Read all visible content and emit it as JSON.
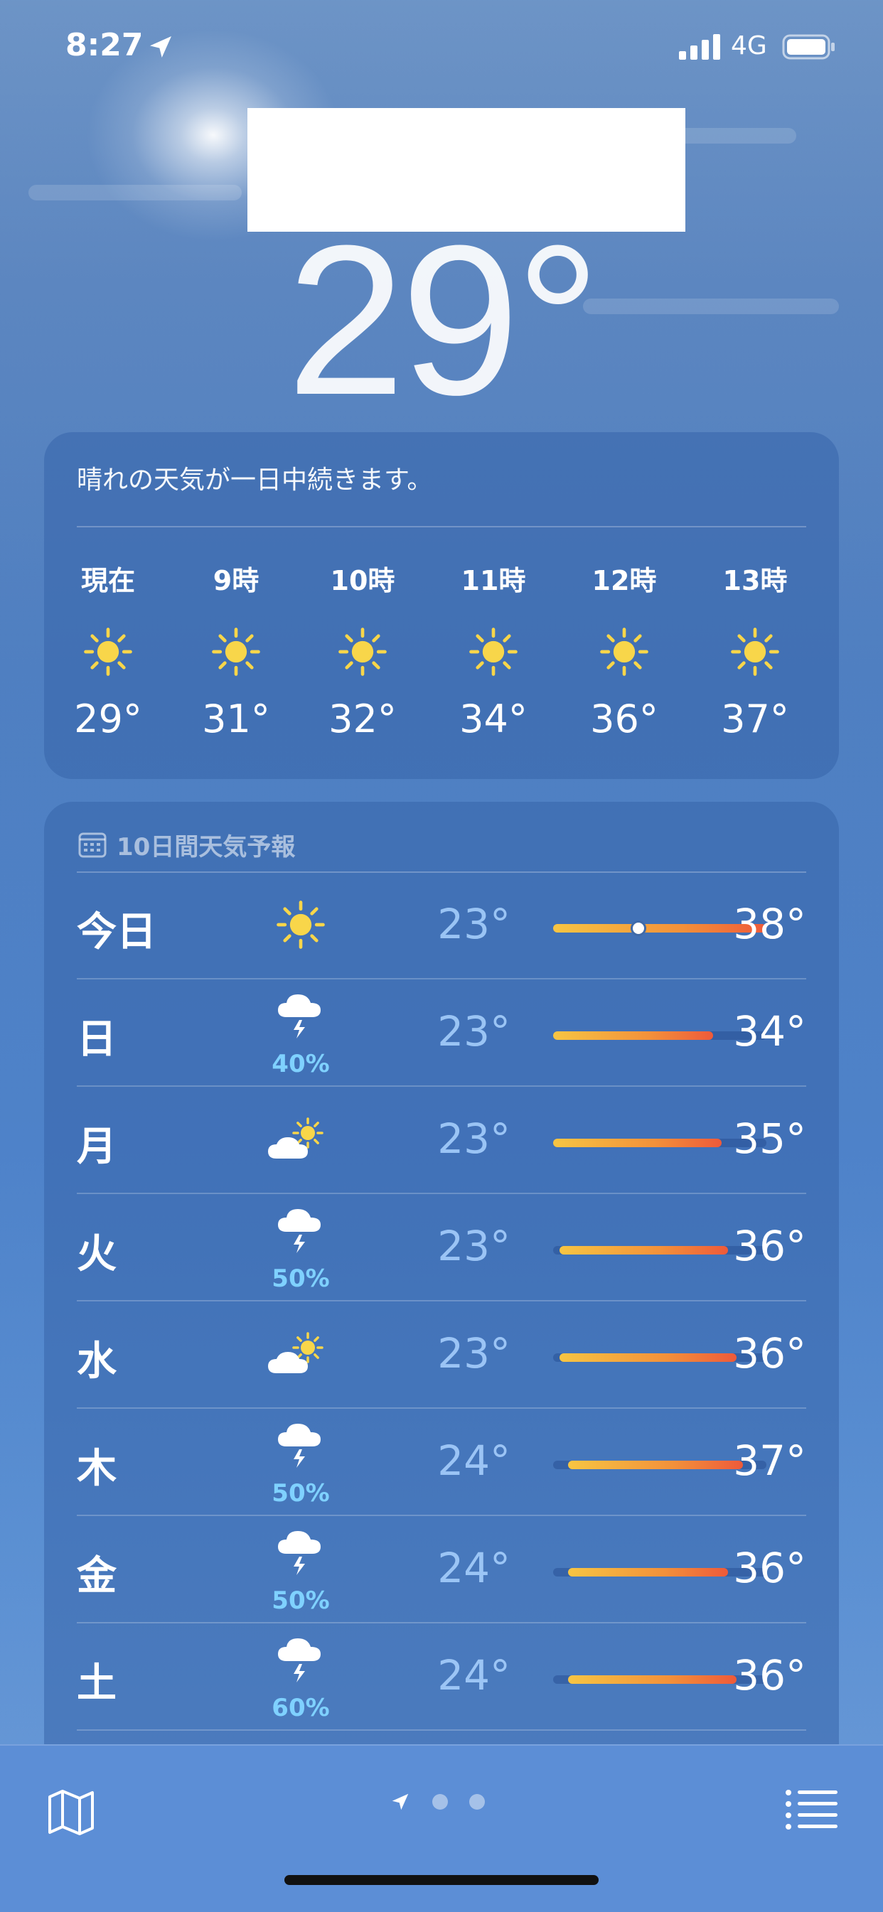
{
  "status": {
    "time": "8:27",
    "network": "4G"
  },
  "header": {
    "temperature": "29°"
  },
  "hourly": {
    "summary": "晴れの天気が一日中続きます。",
    "items": [
      {
        "label": "現在",
        "icon": "sun-icon",
        "temp": "29°"
      },
      {
        "label": "9時",
        "icon": "sun-icon",
        "temp": "31°"
      },
      {
        "label": "10時",
        "icon": "sun-icon",
        "temp": "32°"
      },
      {
        "label": "11時",
        "icon": "sun-icon",
        "temp": "34°"
      },
      {
        "label": "12時",
        "icon": "sun-icon",
        "temp": "36°"
      },
      {
        "label": "13時",
        "icon": "sun-icon",
        "temp": "37°"
      }
    ]
  },
  "daily": {
    "title": "10日間天気予報",
    "days": [
      {
        "name": "今日",
        "icon": "sun-icon",
        "precip": "",
        "low": "23°",
        "high": "38°",
        "bar_start": 0.0,
        "bar_end": 1.0,
        "current": 0.4
      },
      {
        "name": "日",
        "icon": "thunderstorm-icon",
        "precip": "40%",
        "low": "23°",
        "high": "34°",
        "bar_start": 0.0,
        "bar_end": 0.75
      },
      {
        "name": "月",
        "icon": "partly-sunny-icon",
        "precip": "",
        "low": "23°",
        "high": "35°",
        "bar_start": 0.0,
        "bar_end": 0.79
      },
      {
        "name": "火",
        "icon": "thunderstorm-icon",
        "precip": "50%",
        "low": "23°",
        "high": "36°",
        "bar_start": 0.03,
        "bar_end": 0.82
      },
      {
        "name": "水",
        "icon": "partly-sunny-icon",
        "precip": "",
        "low": "23°",
        "high": "36°",
        "bar_start": 0.03,
        "bar_end": 0.86
      },
      {
        "name": "木",
        "icon": "thunderstorm-icon",
        "precip": "50%",
        "low": "24°",
        "high": "37°",
        "bar_start": 0.07,
        "bar_end": 0.89
      },
      {
        "name": "金",
        "icon": "thunderstorm-icon",
        "precip": "50%",
        "low": "24°",
        "high": "36°",
        "bar_start": 0.07,
        "bar_end": 0.82
      },
      {
        "name": "土",
        "icon": "thunderstorm-icon",
        "precip": "60%",
        "low": "24°",
        "high": "36°",
        "bar_start": 0.07,
        "bar_end": 0.86
      }
    ]
  },
  "colors": {
    "sun": "#f8d64a",
    "precip": "#7fd1ff",
    "bar_start": "#f7c543",
    "bar_end": "#ee5a3a"
  }
}
